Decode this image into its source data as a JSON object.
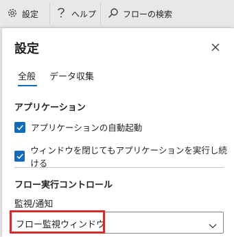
{
  "toolbar": {
    "settings_label": "設定",
    "help_label": "ヘルプ",
    "search_label": "フローの検索"
  },
  "panel": {
    "title": "設定",
    "tabs": [
      {
        "label": "全般",
        "selected": true
      },
      {
        "label": "データ収集",
        "selected": false
      }
    ],
    "app_section": {
      "heading": "アプリケーション",
      "options": [
        {
          "label": "アプリケーションの自動起動",
          "checked": true
        },
        {
          "label": "ウィンドウを閉じてもアプリケーションを実行し続ける",
          "checked": true
        }
      ]
    },
    "flow_section": {
      "heading": "フロー実行コントロール",
      "monitor_label": "監視/通知",
      "monitor_value": "フロー監視ウィンドウ"
    }
  },
  "colors": {
    "accent": "#0f6cbd",
    "highlight": "#d62b2b",
    "toolbar_bg": "#e8e8e8"
  }
}
